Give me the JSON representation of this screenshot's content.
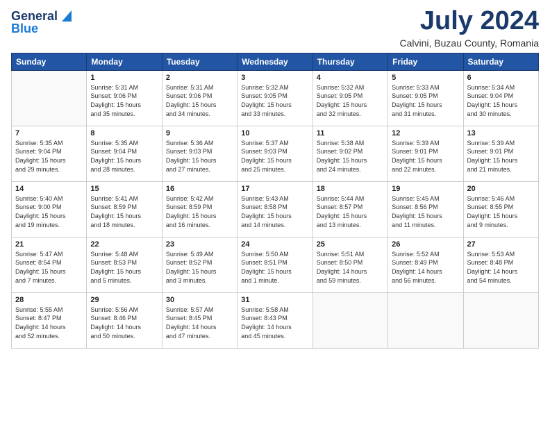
{
  "logo": {
    "general": "General",
    "blue": "Blue"
  },
  "title": "July 2024",
  "subtitle": "Calvini, Buzau County, Romania",
  "days_of_week": [
    "Sunday",
    "Monday",
    "Tuesday",
    "Wednesday",
    "Thursday",
    "Friday",
    "Saturday"
  ],
  "weeks": [
    [
      {
        "day": "",
        "info": ""
      },
      {
        "day": "1",
        "info": "Sunrise: 5:31 AM\nSunset: 9:06 PM\nDaylight: 15 hours\nand 35 minutes."
      },
      {
        "day": "2",
        "info": "Sunrise: 5:31 AM\nSunset: 9:06 PM\nDaylight: 15 hours\nand 34 minutes."
      },
      {
        "day": "3",
        "info": "Sunrise: 5:32 AM\nSunset: 9:05 PM\nDaylight: 15 hours\nand 33 minutes."
      },
      {
        "day": "4",
        "info": "Sunrise: 5:32 AM\nSunset: 9:05 PM\nDaylight: 15 hours\nand 32 minutes."
      },
      {
        "day": "5",
        "info": "Sunrise: 5:33 AM\nSunset: 9:05 PM\nDaylight: 15 hours\nand 31 minutes."
      },
      {
        "day": "6",
        "info": "Sunrise: 5:34 AM\nSunset: 9:04 PM\nDaylight: 15 hours\nand 30 minutes."
      }
    ],
    [
      {
        "day": "7",
        "info": "Sunrise: 5:35 AM\nSunset: 9:04 PM\nDaylight: 15 hours\nand 29 minutes."
      },
      {
        "day": "8",
        "info": "Sunrise: 5:35 AM\nSunset: 9:04 PM\nDaylight: 15 hours\nand 28 minutes."
      },
      {
        "day": "9",
        "info": "Sunrise: 5:36 AM\nSunset: 9:03 PM\nDaylight: 15 hours\nand 27 minutes."
      },
      {
        "day": "10",
        "info": "Sunrise: 5:37 AM\nSunset: 9:03 PM\nDaylight: 15 hours\nand 25 minutes."
      },
      {
        "day": "11",
        "info": "Sunrise: 5:38 AM\nSunset: 9:02 PM\nDaylight: 15 hours\nand 24 minutes."
      },
      {
        "day": "12",
        "info": "Sunrise: 5:39 AM\nSunset: 9:01 PM\nDaylight: 15 hours\nand 22 minutes."
      },
      {
        "day": "13",
        "info": "Sunrise: 5:39 AM\nSunset: 9:01 PM\nDaylight: 15 hours\nand 21 minutes."
      }
    ],
    [
      {
        "day": "14",
        "info": "Sunrise: 5:40 AM\nSunset: 9:00 PM\nDaylight: 15 hours\nand 19 minutes."
      },
      {
        "day": "15",
        "info": "Sunrise: 5:41 AM\nSunset: 8:59 PM\nDaylight: 15 hours\nand 18 minutes."
      },
      {
        "day": "16",
        "info": "Sunrise: 5:42 AM\nSunset: 8:59 PM\nDaylight: 15 hours\nand 16 minutes."
      },
      {
        "day": "17",
        "info": "Sunrise: 5:43 AM\nSunset: 8:58 PM\nDaylight: 15 hours\nand 14 minutes."
      },
      {
        "day": "18",
        "info": "Sunrise: 5:44 AM\nSunset: 8:57 PM\nDaylight: 15 hours\nand 13 minutes."
      },
      {
        "day": "19",
        "info": "Sunrise: 5:45 AM\nSunset: 8:56 PM\nDaylight: 15 hours\nand 11 minutes."
      },
      {
        "day": "20",
        "info": "Sunrise: 5:46 AM\nSunset: 8:55 PM\nDaylight: 15 hours\nand 9 minutes."
      }
    ],
    [
      {
        "day": "21",
        "info": "Sunrise: 5:47 AM\nSunset: 8:54 PM\nDaylight: 15 hours\nand 7 minutes."
      },
      {
        "day": "22",
        "info": "Sunrise: 5:48 AM\nSunset: 8:53 PM\nDaylight: 15 hours\nand 5 minutes."
      },
      {
        "day": "23",
        "info": "Sunrise: 5:49 AM\nSunset: 8:52 PM\nDaylight: 15 hours\nand 3 minutes."
      },
      {
        "day": "24",
        "info": "Sunrise: 5:50 AM\nSunset: 8:51 PM\nDaylight: 15 hours\nand 1 minute."
      },
      {
        "day": "25",
        "info": "Sunrise: 5:51 AM\nSunset: 8:50 PM\nDaylight: 14 hours\nand 59 minutes."
      },
      {
        "day": "26",
        "info": "Sunrise: 5:52 AM\nSunset: 8:49 PM\nDaylight: 14 hours\nand 56 minutes."
      },
      {
        "day": "27",
        "info": "Sunrise: 5:53 AM\nSunset: 8:48 PM\nDaylight: 14 hours\nand 54 minutes."
      }
    ],
    [
      {
        "day": "28",
        "info": "Sunrise: 5:55 AM\nSunset: 8:47 PM\nDaylight: 14 hours\nand 52 minutes."
      },
      {
        "day": "29",
        "info": "Sunrise: 5:56 AM\nSunset: 8:46 PM\nDaylight: 14 hours\nand 50 minutes."
      },
      {
        "day": "30",
        "info": "Sunrise: 5:57 AM\nSunset: 8:45 PM\nDaylight: 14 hours\nand 47 minutes."
      },
      {
        "day": "31",
        "info": "Sunrise: 5:58 AM\nSunset: 8:43 PM\nDaylight: 14 hours\nand 45 minutes."
      },
      {
        "day": "",
        "info": ""
      },
      {
        "day": "",
        "info": ""
      },
      {
        "day": "",
        "info": ""
      }
    ]
  ]
}
